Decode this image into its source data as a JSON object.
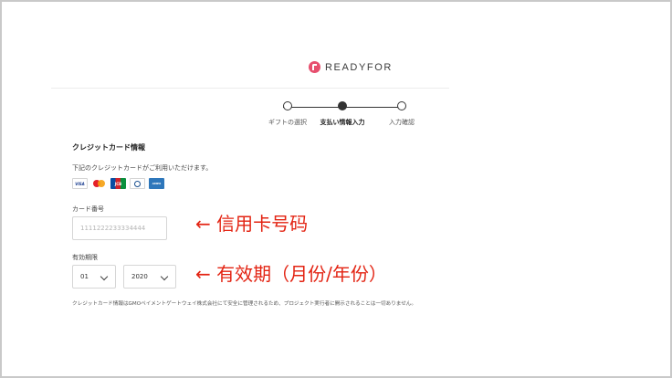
{
  "brand": {
    "name": "READYFOR",
    "color": "#e74f6e"
  },
  "steps": [
    {
      "label": "ギフトの選択",
      "active": false
    },
    {
      "label": "支払い情報入力",
      "active": true
    },
    {
      "label": "入力確認",
      "active": false
    }
  ],
  "section": {
    "title": "クレジットカード情報",
    "description": "下記のクレジットカードがご利用いただけます。",
    "cards": [
      {
        "name": "VISA",
        "icon": "visa-icon"
      },
      {
        "name": "Mastercard",
        "icon": "mastercard-icon"
      },
      {
        "name": "JCB",
        "icon": "jcb-icon"
      },
      {
        "name": "Diners Club",
        "icon": "diners-icon"
      },
      {
        "name": "American Express",
        "icon": "amex-icon"
      }
    ]
  },
  "card_number": {
    "label": "カード番号",
    "placeholder": "1111222233334444",
    "value": ""
  },
  "expiry": {
    "label": "有効期限",
    "month": "01",
    "year": "2020"
  },
  "note": "クレジットカード情報はGMOペイメントゲートウェイ株式会社にて安全に管理されるため、プロジェクト実行者に開示されることは一切ありません。",
  "annotations": {
    "card_number": "← 信用卡号码",
    "expiry": "← 有效期（月份/年份）",
    "color": "#e32413"
  }
}
